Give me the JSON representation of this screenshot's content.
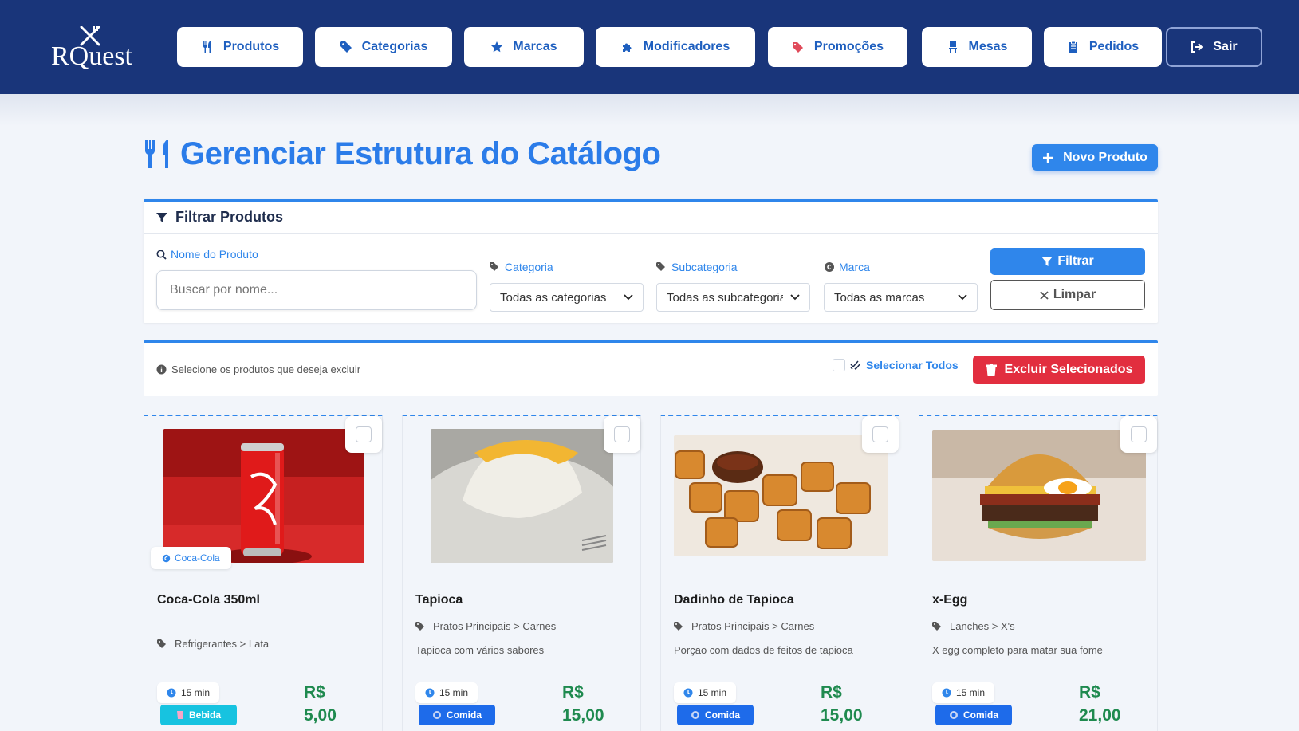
{
  "app": {
    "logo_text": "RQuest"
  },
  "nav": {
    "items": [
      {
        "label": "Produtos",
        "icon": "utensils-icon"
      },
      {
        "label": "Categorias",
        "icon": "tag-icon"
      },
      {
        "label": "Marcas",
        "icon": "star-icon"
      },
      {
        "label": "Modificadores",
        "icon": "puzzle-icon"
      },
      {
        "label": "Promoções",
        "icon": "tags-icon"
      },
      {
        "label": "Mesas",
        "icon": "chair-icon"
      },
      {
        "label": "Pedidos",
        "icon": "clipboard-icon"
      }
    ],
    "logout_label": "Sair"
  },
  "page": {
    "title": "Gerenciar Estrutura do Catálogo",
    "new_product_label": "Novo Produto"
  },
  "filter": {
    "heading": "Filtrar Produtos",
    "name_label": "Nome do Produto",
    "name_placeholder": "Buscar por nome...",
    "category_label": "Categoria",
    "category_value": "Todas as categorias",
    "subcategory_label": "Subcategoria",
    "subcategory_value": "Todas as subcategorias",
    "brand_label": "Marca",
    "brand_value": "Todas as marcas",
    "filter_button": "Filtrar",
    "clear_button": "Limpar"
  },
  "selection": {
    "hint": "Selecione os produtos que deseja excluir",
    "select_all_label": "Selecionar Todos",
    "delete_selected_label": "Excluir Selecionados"
  },
  "products": [
    {
      "name": "Coca-Cola 350ml",
      "brand": "Coca-Cola",
      "category": "Refrigerantes > Lata",
      "description": "",
      "time": "15 min",
      "type": "Bebida",
      "currency": "R$",
      "price": "5,00"
    },
    {
      "name": "Tapioca",
      "brand": "",
      "category": "Pratos Principais > Carnes",
      "description": "Tapioca com vários sabores",
      "time": "15 min",
      "type": "Comida",
      "currency": "R$",
      "price": "15,00"
    },
    {
      "name": "Dadinho de Tapioca",
      "brand": "",
      "category": "Pratos Principais > Carnes",
      "description": "Porçao com dados de feitos de tapioca",
      "time": "15 min",
      "type": "Comida",
      "currency": "R$",
      "price": "15,00"
    },
    {
      "name": "x-Egg",
      "brand": "",
      "category": "Lanches > X's",
      "description": "X egg completo para matar sua fome",
      "time": "15 min",
      "type": "Comida",
      "currency": "R$",
      "price": "21,00"
    }
  ],
  "colors": {
    "nav_bg": "#19357a",
    "accent": "#2f86eb",
    "danger": "#e22e3f",
    "price": "#1f8a4f"
  }
}
